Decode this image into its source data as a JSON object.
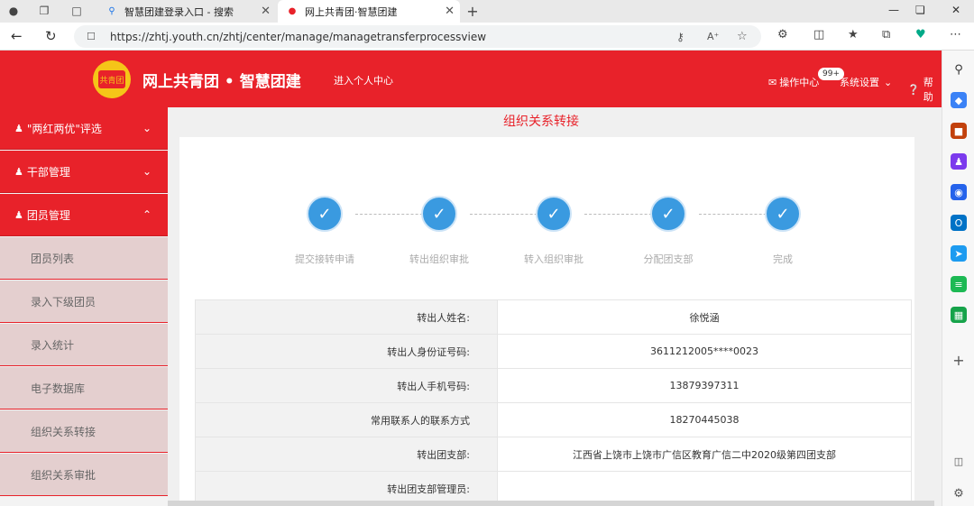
{
  "browser": {
    "tabs": [
      {
        "title": "智慧团建登录入口 - 搜索",
        "icon": "search-icon",
        "active": false
      },
      {
        "title": "网上共青团·智慧团建",
        "icon": "league-emblem-icon",
        "active": true
      }
    ],
    "new_tab": "+",
    "url": "https://zhtj.youth.cn/zhtj/center/manage/managetransferprocessview"
  },
  "header": {
    "logo_text": "共青团",
    "site_title": "网上共青团 • 智慧团建",
    "personal_center": "进入个人中心",
    "ops_center": "操作中心",
    "badge": "99+",
    "settings": "系统设置",
    "help": "帮助"
  },
  "sidebar": {
    "groups": [
      {
        "label": "\"两红两优\"评选",
        "expanded": false
      },
      {
        "label": "干部管理",
        "expanded": false
      },
      {
        "label": "团员管理",
        "expanded": true
      }
    ],
    "sub_items": [
      "团员列表",
      "录入下级团员",
      "录入统计",
      "电子数据库",
      "组织关系转接",
      "组织关系审批"
    ]
  },
  "main": {
    "title": "组织关系转接",
    "steps": [
      "提交接转申请",
      "转出组织审批",
      "转入组织审批",
      "分配团支部",
      "完成"
    ],
    "rows": [
      {
        "label": "转出人姓名:",
        "value": "徐悦涵"
      },
      {
        "label": "转出人身份证号码:",
        "value": "3611212005****0023"
      },
      {
        "label": "转出人手机号码:",
        "value": "13879397311"
      },
      {
        "label": "常用联系人的联系方式",
        "value": "18270445038"
      },
      {
        "label": "转出团支部:",
        "value": "江西省上饶市上饶市广信区教育广信二中2020级第四团支部"
      },
      {
        "label": "转出团支部管理员:",
        "value": ""
      }
    ]
  },
  "colors": {
    "brand_red": "#e8222a",
    "step_blue": "#3a9ae0"
  }
}
